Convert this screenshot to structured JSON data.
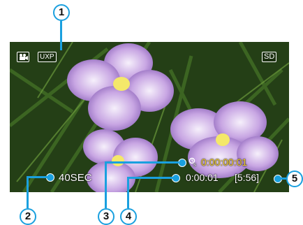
{
  "screen": {
    "mode_icon": "video-camera-icon",
    "quality": "UXP",
    "media": "SD",
    "remaining_label": "40SEC",
    "interval_icon": "time-lapse-icon",
    "interval_counter": "0:00:00:01",
    "record_time": "0:00:01",
    "remaining_time": "[5:56]"
  },
  "callouts": [
    "1",
    "2",
    "3",
    "4",
    "5"
  ],
  "colors": {
    "callout": "#1aa0df",
    "counter_yellow": "#f6d22b"
  }
}
